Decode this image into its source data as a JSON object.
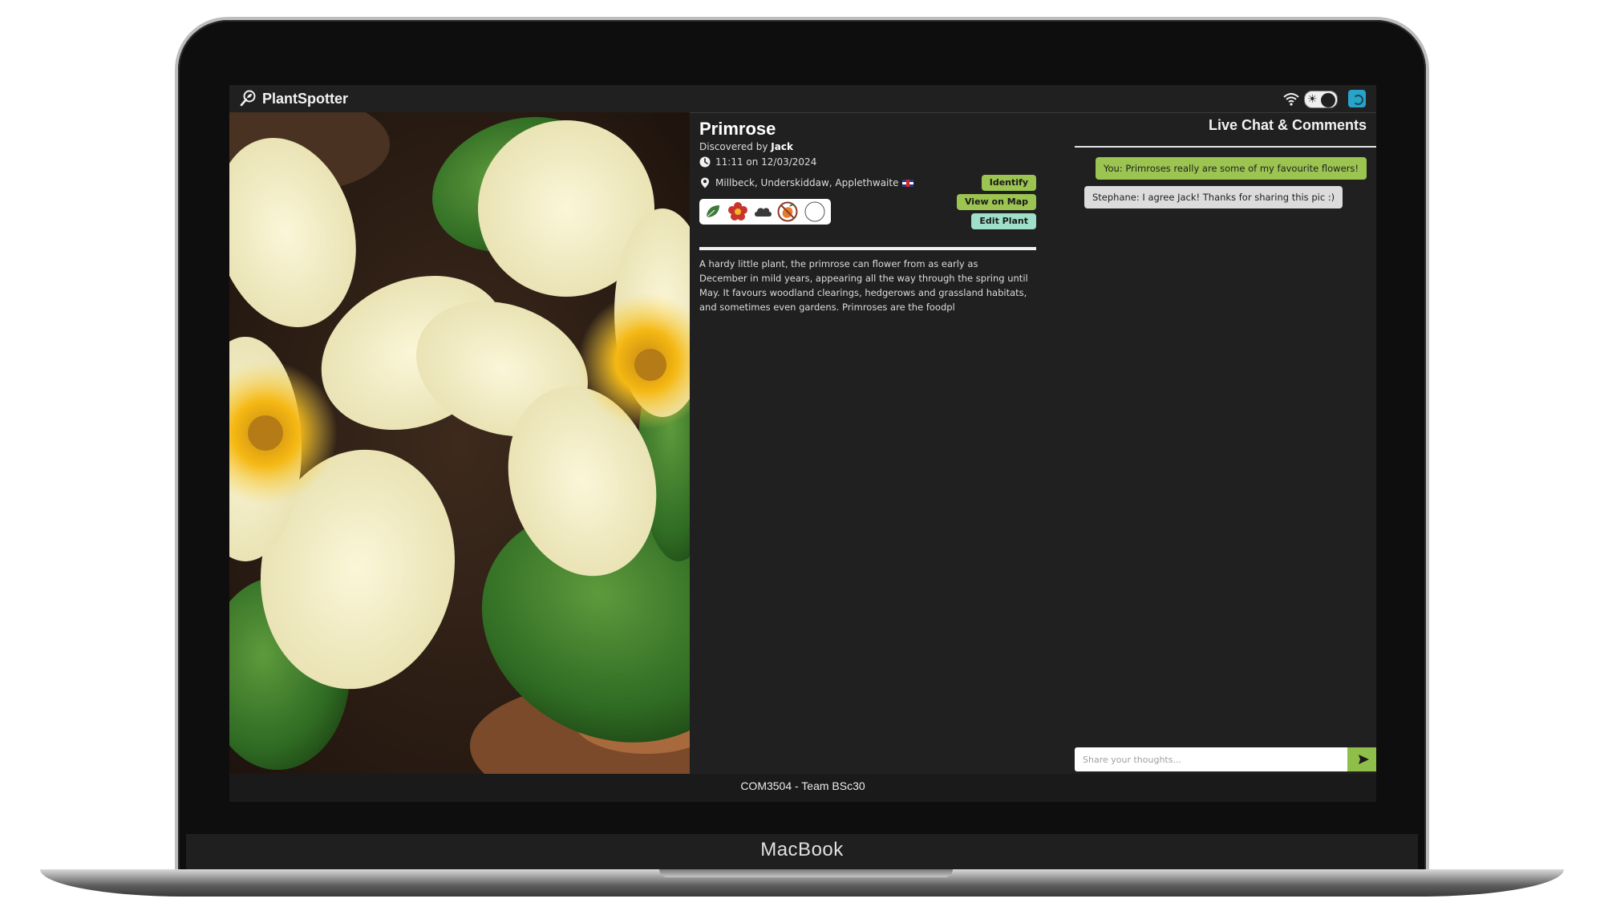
{
  "device_label": "MacBook",
  "app": {
    "title": "PlantSpotter"
  },
  "plant": {
    "name": "Primrose",
    "discovered_prefix": "Discovered by",
    "discoverer": "Jack",
    "time": "11:11 on 12/03/2024",
    "location": "Millbeck, Underskiddaw, Applethwaite",
    "description": "A hardy little plant, the primrose can flower from as early as December in mild years, appearing all the way through the spring until May. It favours woodland clearings, hedgerows and grassland habitats, and sometimes even gardens. Primroses are the foodpl",
    "characteristic_icons": [
      "leaf-icon",
      "flower-icon",
      "cloud-icon",
      "no-fruit-icon",
      "empty-circle-icon"
    ]
  },
  "actions": {
    "identify": "Identify",
    "view_on_map": "View on Map",
    "edit_plant": "Edit Plant"
  },
  "chat": {
    "title": "Live Chat & Comments",
    "messages": [
      {
        "text": "You: Primroses really are some of my favourite flowers!"
      },
      {
        "text": "Stephane: I agree Jack! Thanks for sharing this pic :)"
      }
    ],
    "input_placeholder": "Share your thoughts..."
  },
  "footer": {
    "text": "COM3504 - Team BSc30"
  },
  "colors": {
    "accent_green": "#9bc450",
    "edit_button": "#9ee0c9",
    "background": "#202020",
    "avatar": "#2aa3c9"
  }
}
